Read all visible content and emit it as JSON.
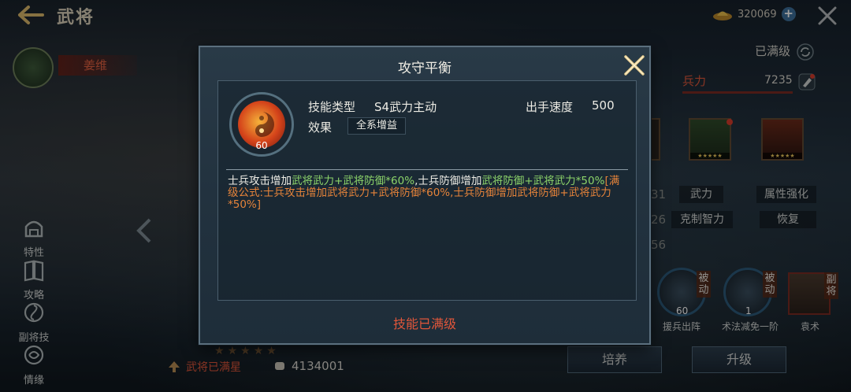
{
  "header": {
    "title": "武将",
    "currency_value": "320069"
  },
  "hero": {
    "name": "姜维"
  },
  "sidebar": {
    "items": [
      {
        "label": "特性",
        "icon": "helmet-icon"
      },
      {
        "label": "攻略",
        "icon": "book-icon"
      },
      {
        "label": "副将技",
        "icon": "swirl-icon"
      },
      {
        "label": "情缘",
        "icon": "bond-icon"
      }
    ]
  },
  "bottom_left": {
    "star_status": "武将已满星",
    "power": "4134001"
  },
  "right_panel": {
    "level_status": "已满级",
    "troops_label": "兵力",
    "troops_value": "7235",
    "attr_tags": [
      "武力",
      "属性强化",
      "克制智力",
      "恢复"
    ],
    "partial_numbers": [
      "31",
      "26",
      "56"
    ],
    "skills": [
      {
        "tag": "被动",
        "level": "60",
        "name": "援兵出阵"
      },
      {
        "tag": "被动",
        "level": "1",
        "name": "术法减免一阶"
      }
    ],
    "deputy": {
      "tag": "副将",
      "name": "袁术"
    },
    "buttons": {
      "train": "培养",
      "upgrade": "升级"
    }
  },
  "modal": {
    "title": "攻守平衡",
    "skill_level": "60",
    "skill_type_label": "技能类型",
    "skill_type_value": "S4武力主动",
    "speed_label": "出手速度",
    "speed_value": "500",
    "effect_label": "效果",
    "effect_value": "全系增益",
    "desc": {
      "p1": "士兵攻击增加",
      "g1": "武将武力+武将防御*60%",
      "p2": ",士兵防御增加",
      "g2": "武将防御+武将武力*50%",
      "o1": "[满级公式:士兵攻击增加武将武力+武将防御*60%,士兵防御增加武将防御+武将武力*50%]"
    },
    "footer": "技能已满级"
  },
  "colors": {
    "accent_red": "#e0563a",
    "formula_green": "#8cd46a",
    "formula_orange": "#e5833a"
  }
}
